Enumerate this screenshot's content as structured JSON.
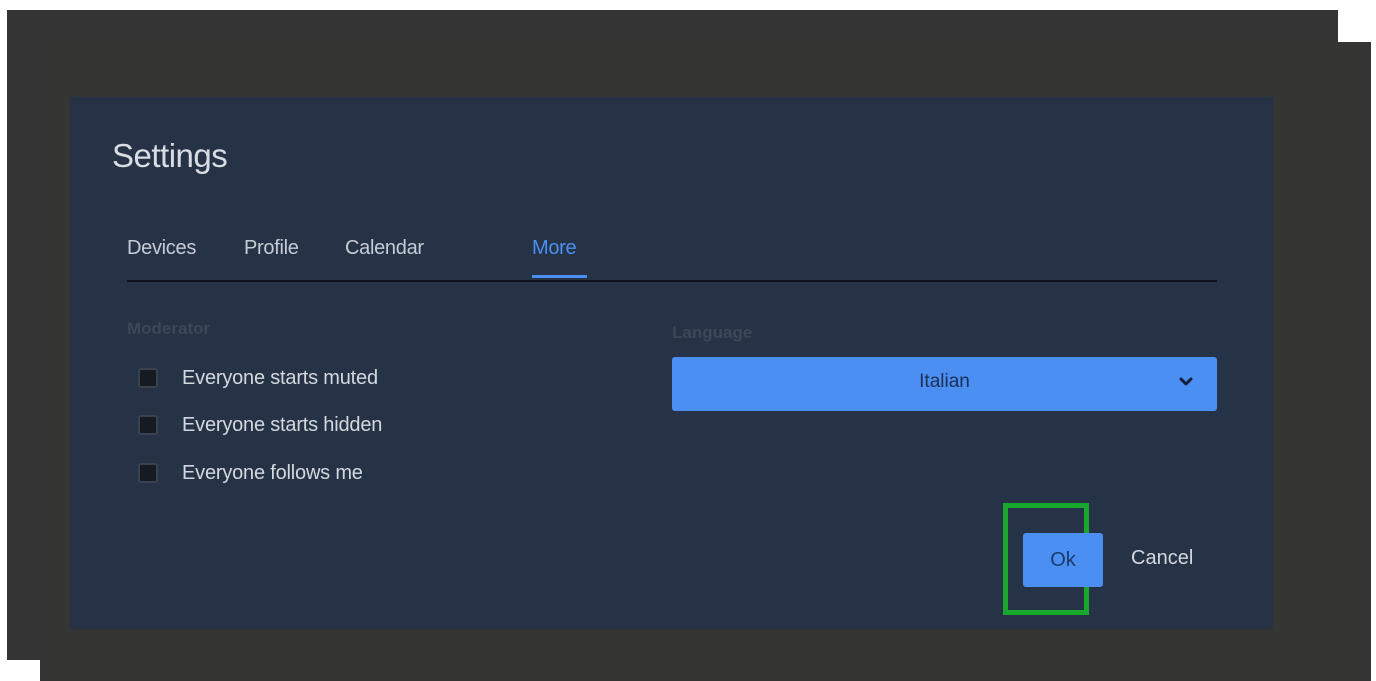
{
  "dialog": {
    "title": "Settings",
    "tabs": [
      {
        "label": "Devices",
        "active": false
      },
      {
        "label": "Profile",
        "active": false
      },
      {
        "label": "Calendar",
        "active": false
      },
      {
        "label": "More",
        "active": true
      }
    ]
  },
  "moderator": {
    "heading": "Moderator",
    "options": [
      {
        "label": "Everyone starts muted",
        "checked": false
      },
      {
        "label": "Everyone starts hidden",
        "checked": false
      },
      {
        "label": "Everyone follows me",
        "checked": false
      }
    ]
  },
  "language": {
    "heading": "Language",
    "selected": "Italian",
    "icon": "chevron-down-icon"
  },
  "actions": {
    "ok_label": "Ok",
    "cancel_label": "Cancel"
  },
  "colors": {
    "dialog_background": "#263346",
    "accent": "#4b8ff2",
    "highlight": "#18a82e"
  }
}
